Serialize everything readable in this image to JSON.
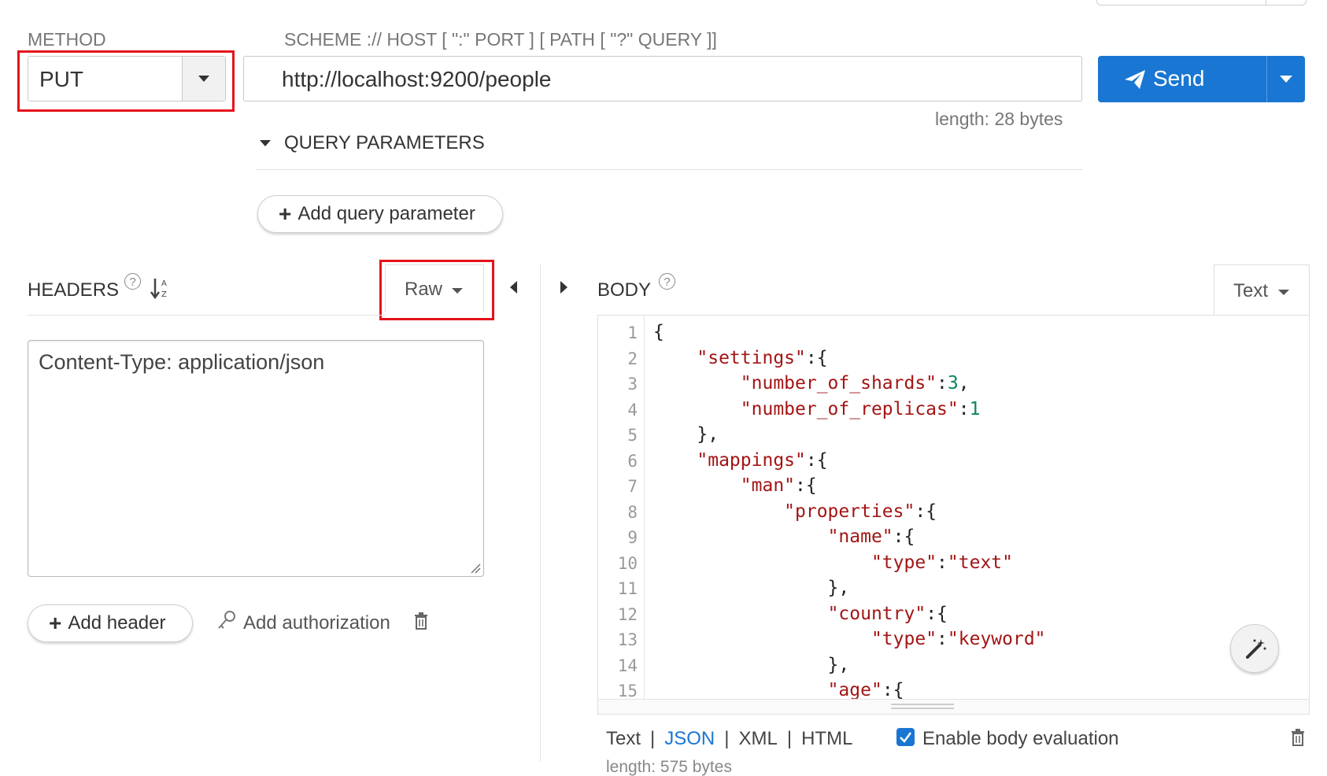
{
  "method": {
    "label": "METHOD",
    "value": "PUT"
  },
  "url": {
    "label": "SCHEME :// HOST [ \":\" PORT ] [ PATH [ \"?\" QUERY ]]",
    "value": "http://localhost:9200/people",
    "length": "length: 28 bytes"
  },
  "send": {
    "label": "Send"
  },
  "query": {
    "title": "QUERY PARAMETERS",
    "add_label": "Add query parameter"
  },
  "headers": {
    "title": "HEADERS",
    "help": "?",
    "sort_icon": "sort-alpha-icon",
    "mode": "Raw",
    "content": "Content-Type: application/json",
    "add_header": "Add header",
    "add_auth": "Add authorization"
  },
  "body": {
    "title": "BODY",
    "help": "?",
    "mode": "Text",
    "line_numbers": [
      "1",
      "2",
      "3",
      "4",
      "5",
      "6",
      "7",
      "8",
      "9",
      "10",
      "11",
      "12",
      "13",
      "14",
      "15"
    ],
    "lines": [
      "{",
      "    \"settings\":{",
      "        \"number_of_shards\":3,",
      "        \"number_of_replicas\":1",
      "    },",
      "    \"mappings\":{",
      "        \"man\":{",
      "            \"properties\":{",
      "                \"name\":{",
      "                    \"type\":\"text\"",
      "                },",
      "                \"country\":{",
      "                    \"type\":\"keyword\"",
      "                },",
      "                \"age\":{"
    ],
    "formats": [
      "Text",
      "JSON",
      "XML",
      "HTML"
    ],
    "active_format": "JSON",
    "evaluation_label": "Enable body evaluation",
    "length": "length: 575 bytes"
  },
  "colors": {
    "accent": "#1976d2",
    "highlight": "#e5121b",
    "string": "#a31515",
    "number": "#098658"
  }
}
